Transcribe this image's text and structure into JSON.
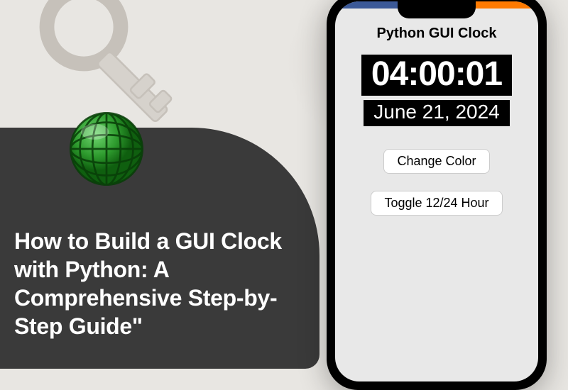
{
  "article": {
    "title": "How to Build a GUI Clock with Python: A Comprehensive Step-by-Step Guide\""
  },
  "logo": {
    "name": "globe-logo",
    "color": "#2e9b2e"
  },
  "phone": {
    "app_title": "Python GUI Clock",
    "time": "04:00:01",
    "date": "June 21, 2024",
    "buttons": {
      "change_color": "Change Color",
      "toggle_format": "Toggle 12/24 Hour"
    }
  }
}
